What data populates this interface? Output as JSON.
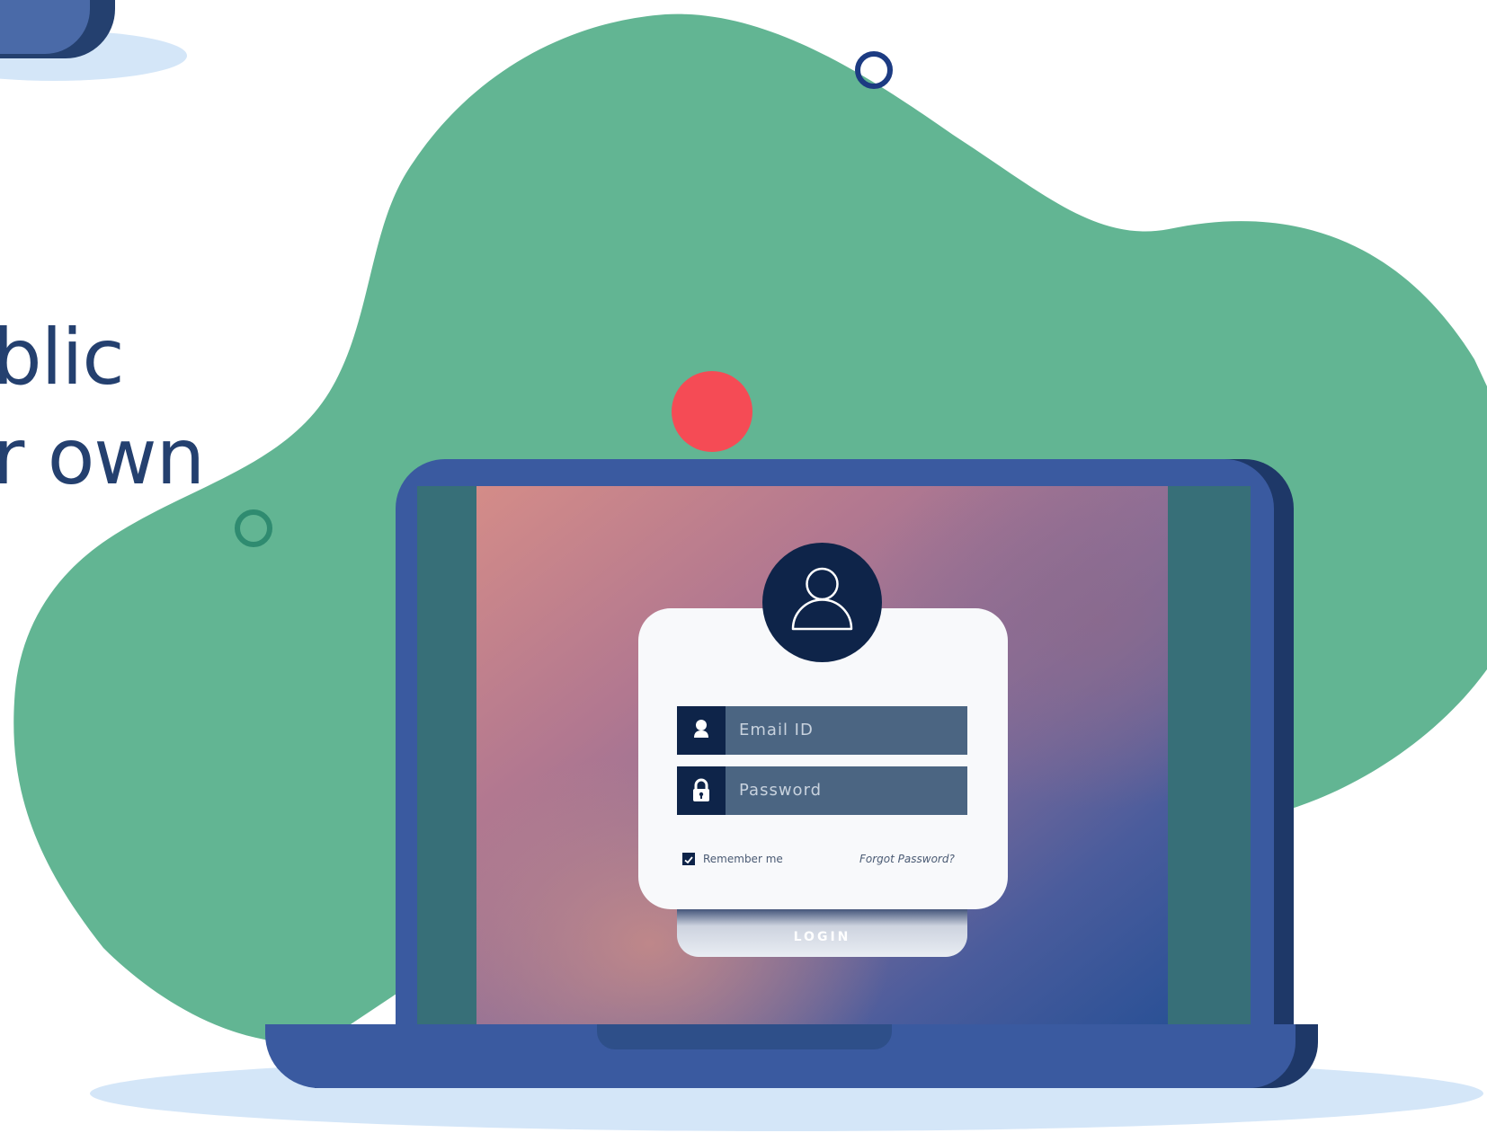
{
  "headline": {
    "line1": "blic",
    "line2": "r own"
  },
  "login_form": {
    "email_placeholder": "Email ID",
    "password_placeholder": "Password",
    "remember_label": "Remember me",
    "remember_checked": true,
    "forgot_link": "Forgot Password?",
    "login_button": "LOGIN"
  },
  "icons": {
    "avatar": "user-outline-icon",
    "email": "user-icon",
    "password": "lock-icon",
    "checkbox": "check-icon"
  },
  "colors": {
    "blob_green": "#62b593",
    "laptop_blue": "#3a5aa0",
    "laptop_shadow": "#1e3868",
    "navy": "#0e2449",
    "accent_red": "#f54b55",
    "floor_shadow": "#d4e6f8",
    "headline": "#24406f"
  }
}
